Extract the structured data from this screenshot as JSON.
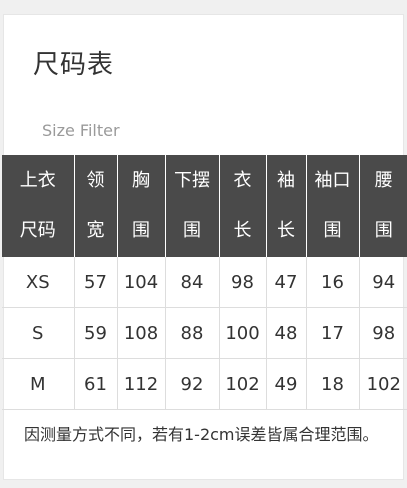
{
  "title": "尺码表",
  "filter_label": "Size Filter",
  "table": {
    "headers": [
      {
        "line1": "上衣",
        "line2": "尺码"
      },
      {
        "line1": "领",
        "line2": "宽"
      },
      {
        "line1": "胸",
        "line2": "围"
      },
      {
        "line1": "下摆",
        "line2": "围"
      },
      {
        "line1": "衣",
        "line2": "长"
      },
      {
        "line1": "袖",
        "line2": "长"
      },
      {
        "line1": "袖口",
        "line2": "围"
      },
      {
        "line1": "腰",
        "line2": "围"
      }
    ],
    "rows": [
      [
        "XS",
        "57",
        "104",
        "84",
        "98",
        "47",
        "16",
        "94"
      ],
      [
        "S",
        "59",
        "108",
        "88",
        "100",
        "48",
        "17",
        "98"
      ],
      [
        "M",
        "61",
        "112",
        "92",
        "102",
        "49",
        "18",
        "102"
      ]
    ]
  },
  "note": "因测量方式不同，若有1-2cm误差皆属合理范围。"
}
